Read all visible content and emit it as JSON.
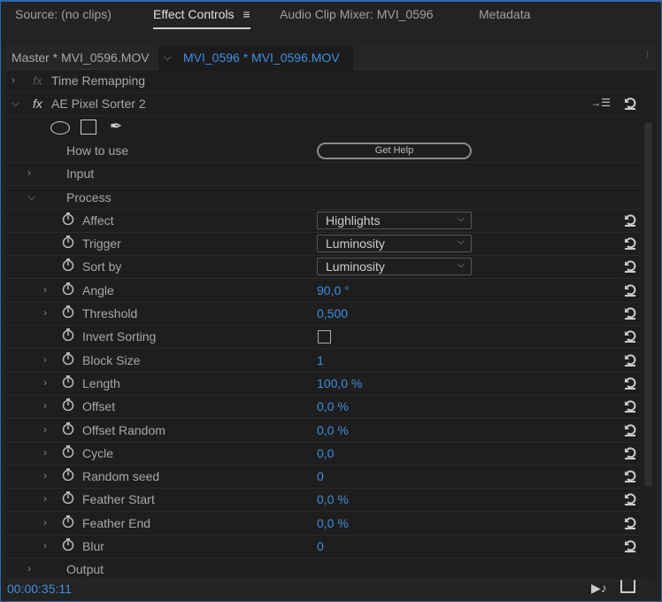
{
  "tabs": [
    "Source: (no clips)",
    "Effect Controls",
    "Audio Clip Mixer: MVI_0596",
    "Metadata"
  ],
  "sequence": {
    "master": "Master * MVI_0596.MOV",
    "clip": "MVI_0596 * MVI_0596.MOV"
  },
  "effects": {
    "time_remapping": "Time Remapping",
    "pixel_sorter": "AE Pixel Sorter 2",
    "how_to_use": "How to use",
    "get_help": "Get Help",
    "input": "Input",
    "process": "Process",
    "output": "Output"
  },
  "params": [
    {
      "label": "Affect",
      "type": "dropdown",
      "value": "Highlights",
      "expand": false
    },
    {
      "label": "Trigger",
      "type": "dropdown",
      "value": "Luminosity",
      "expand": false
    },
    {
      "label": "Sort by",
      "type": "dropdown",
      "value": "Luminosity",
      "expand": false
    },
    {
      "label": "Angle",
      "type": "value",
      "value": "90,0 °",
      "expand": true
    },
    {
      "label": "Threshold",
      "type": "value",
      "value": "0,500",
      "expand": true
    },
    {
      "label": "Invert Sorting",
      "type": "checkbox",
      "value": "",
      "checked": false,
      "expand": false
    },
    {
      "label": "Block Size",
      "type": "value",
      "value": "1",
      "expand": true
    },
    {
      "label": "Length",
      "type": "value",
      "value": "100,0 %",
      "expand": true
    },
    {
      "label": "Offset",
      "type": "value",
      "value": "0,0 %",
      "expand": true
    },
    {
      "label": "Offset Random",
      "type": "value",
      "value": "0,0 %",
      "expand": true
    },
    {
      "label": "Cycle",
      "type": "value",
      "value": "0,0",
      "expand": true
    },
    {
      "label": "Random seed",
      "type": "value",
      "value": "0",
      "expand": true
    },
    {
      "label": "Feather Start",
      "type": "value",
      "value": "0,0 %",
      "expand": true
    },
    {
      "label": "Feather End",
      "type": "value",
      "value": "0,0 %",
      "expand": true
    },
    {
      "label": "Blur",
      "type": "value",
      "value": "0",
      "expand": true
    }
  ],
  "timecode": "00:00:35:11",
  "colors": {
    "accent": "#3f8fe0",
    "panel": "#1e1e1e"
  }
}
